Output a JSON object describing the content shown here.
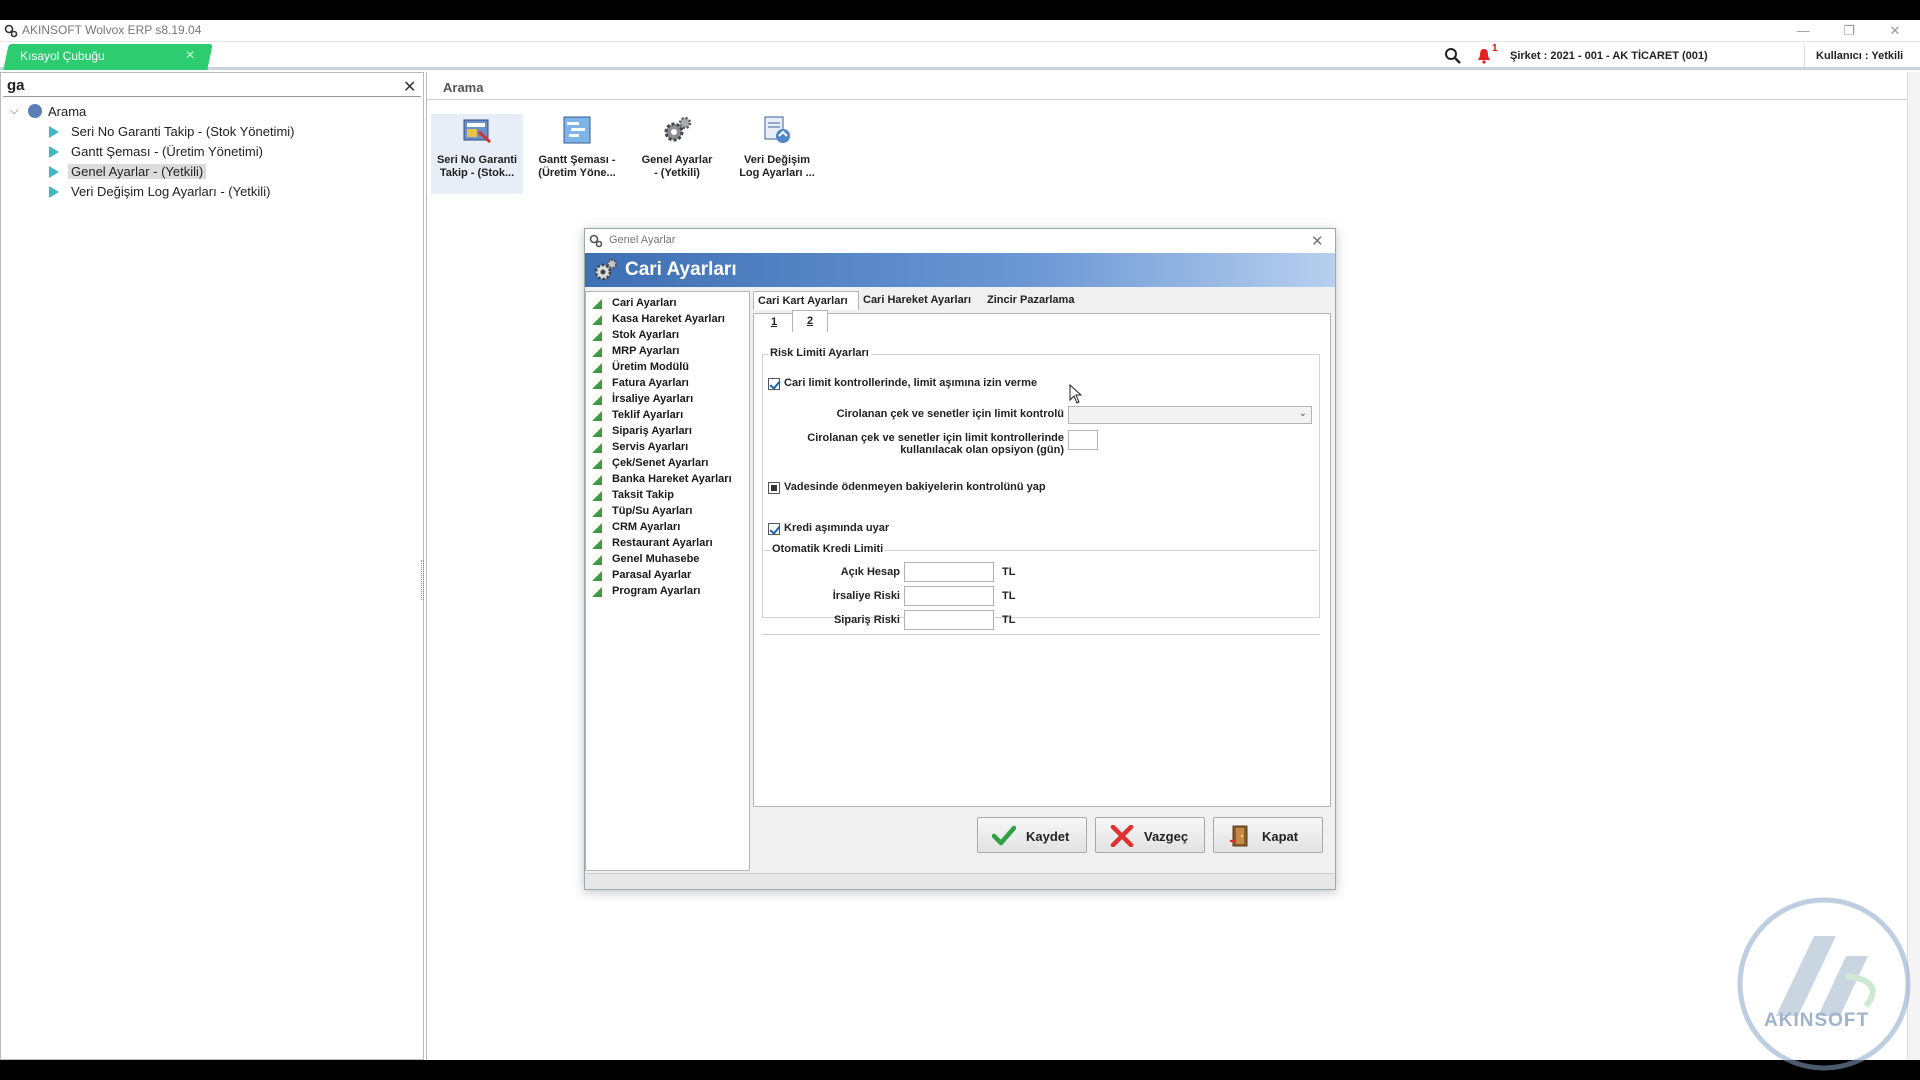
{
  "window": {
    "title": "AKINSOFT Wolvox ERP s8.19.04",
    "minimize": "—",
    "restore": "❐",
    "close": "✕"
  },
  "topbar": {
    "shortcut_tab": "Kısayol Çubuğu",
    "shortcut_close": "✕",
    "notification_count": "1",
    "company": "Şirket : 2021 - 001 - AK TİCARET (001)",
    "user": "Kullanıcı : Yetkili"
  },
  "left_panel": {
    "search_value": "ga",
    "clear": "✕",
    "root_label": "Arama",
    "items": [
      {
        "label": "Seri No Garanti Takip - (Stok Yönetimi)"
      },
      {
        "label": "Gantt Şeması - (Üretim Yönetimi)"
      },
      {
        "label": "Genel Ayarlar - (Yetkili)",
        "selected": true
      },
      {
        "label": "Veri Değişim Log Ayarları - (Yetkili)"
      }
    ]
  },
  "main": {
    "title": "Arama",
    "launchers": [
      {
        "line1": "Seri No Garanti",
        "line2": "Takip - (Stok...",
        "icon": "serial-warranty-icon"
      },
      {
        "line1": "Gantt Şeması -",
        "line2": "(Üretim Yöne...",
        "icon": "gantt-chart-icon"
      },
      {
        "line1": "Genel Ayarlar",
        "line2": "- (Yetkili)",
        "icon": "gears-icon"
      },
      {
        "line1": "Veri Değişim",
        "line2": "Log Ayarları ...",
        "icon": "data-log-icon"
      }
    ]
  },
  "dialog": {
    "window_title": "Genel Ayarlar",
    "close": "✕",
    "banner_title": "Cari Ayarları",
    "categories": [
      "Cari Ayarları",
      "Kasa Hareket Ayarları",
      "Stok Ayarları",
      "MRP Ayarları",
      "Üretim Modülü",
      "Fatura Ayarları",
      "İrsaliye Ayarları",
      "Teklif Ayarları",
      "Sipariş Ayarları",
      "Servis Ayarları",
      "Çek/Senet Ayarları",
      "Banka Hareket Ayarları",
      "Taksit Takip",
      "Tüp/Su Ayarları",
      "CRM Ayarları",
      "Restaurant Ayarları",
      "Genel Muhasebe",
      "Parasal Ayarlar",
      "Program Ayarları"
    ],
    "tabs": [
      "Cari Kart Ayarları",
      "Cari Hareket Ayarları",
      "Zincir Pazarlama"
    ],
    "subtabs": [
      "1",
      "2"
    ],
    "risk_group": "Risk Limiti Ayarları",
    "chk_limit": "Cari limit kontrollerinde, limit aşımına izin verme",
    "lbl_ciro_control": "Cirolanan çek ve senetler için limit kontrolü",
    "ciro_control_value": "",
    "lbl_ciro_option_1": "Cirolanan çek ve senetler için limit kontrollerinde",
    "lbl_ciro_option_2": "kullanılacak olan opsiyon (gün)",
    "ciro_option_value": "",
    "chk_overdue": "Vadesinde ödenmeyen bakiyelerin kontrolünü yap",
    "chk_credit_warn": "Kredi aşımında uyar",
    "auto_credit_group": "Otomatik Kredi Limiti",
    "fields": [
      {
        "label": "Açık Hesap",
        "value": "",
        "unit": "TL"
      },
      {
        "label": "İrsaliye Riski",
        "value": "",
        "unit": "TL"
      },
      {
        "label": "Sipariş Riski",
        "value": "",
        "unit": "TL"
      }
    ],
    "buttons": {
      "save": "Kaydet",
      "cancel": "Vazgeç",
      "close": "Kapat"
    }
  },
  "watermark": "AKINSOFT"
}
